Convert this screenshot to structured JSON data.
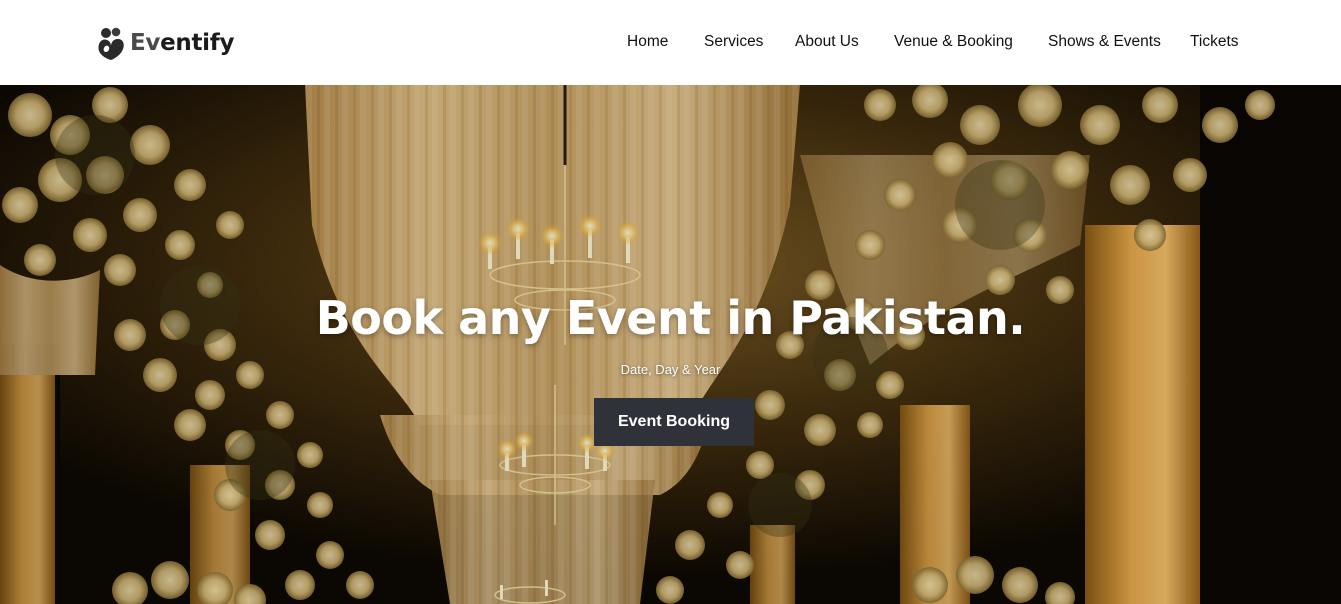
{
  "brand": {
    "name_part1": "Ev",
    "name_part2": "entify",
    "logo_icon": "heart-hands-icon"
  },
  "nav": {
    "items": [
      {
        "label": "Home"
      },
      {
        "label": "Services"
      },
      {
        "label": "About Us"
      },
      {
        "label": "Venue & Booking"
      },
      {
        "label": "Shows & Events"
      },
      {
        "label": "Tickets"
      }
    ]
  },
  "hero": {
    "title": "Book any Event in Pakistan.",
    "subtitle": "Date, Day & Year",
    "cta_label": "Event Booking",
    "background_icon": "wedding-venue-chandelier-florals-photo"
  },
  "colors": {
    "header_bg": "#ffffff",
    "nav_text": "#111111",
    "button_bg": "#2f3238",
    "hero_text": "#ffffff",
    "accent_gold": "#c79a3e"
  }
}
